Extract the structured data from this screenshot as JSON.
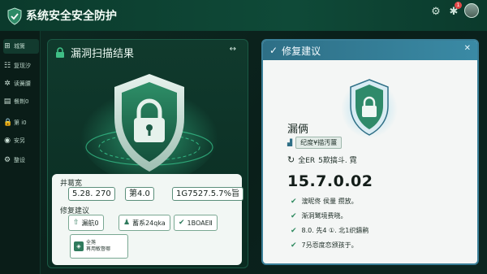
{
  "app": {
    "title": "系统安全安全防护"
  },
  "titlebar": {
    "settings_icon": "gear-icon",
    "notify_icon": "bell-icon",
    "notify_count": "1"
  },
  "sidebar": {
    "items": [
      {
        "label": "城篱",
        "icon": "⊞"
      },
      {
        "label": "复现汐",
        "icon": "☷"
      },
      {
        "label": "读簧腰",
        "icon": "✲"
      },
      {
        "label": "餐荆0",
        "icon": "▤"
      },
      {
        "label": "第 ⅰ0",
        "icon": "🔒"
      },
      {
        "label": "安另",
        "icon": "◉"
      },
      {
        "label": "整设",
        "icon": "⚙"
      }
    ]
  },
  "scan_panel": {
    "title": "漏洞扫描结果",
    "more": "↔"
  },
  "summary": {
    "title": "井葛宽",
    "stats": [
      "5.28. 270",
      "第4.0",
      "1G7527.5.7%旨"
    ],
    "title2": "修复建议",
    "chips": [
      "漏航0",
      "蓄系24qka",
      "1BOAEⅡ"
    ],
    "tile_lines": [
      "全荛",
      "苒用敏督哪"
    ]
  },
  "reco": {
    "title": "修复建议",
    "heading": "漏俩",
    "row1": "纪度¥描汚薑",
    "row2_prefix": "全ER",
    "row2_text": "5欺搞斗. 霓",
    "version": "15.7.0.02",
    "checks": [
      "溲昵佟  侯量  攒放。",
      "渐洞鹫境费晓。",
      "8.0. 先4 ①. 北1织鑄鹃",
      "7叧恧度恋颁孩于。"
    ]
  }
}
